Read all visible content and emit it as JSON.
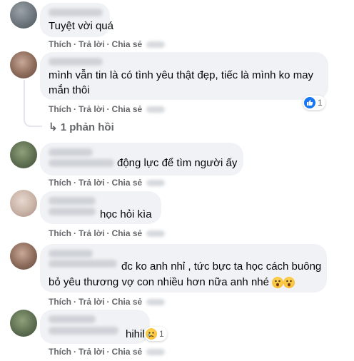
{
  "actions": {
    "like": "Thích",
    "reply": "Trả lời",
    "share": "Chia sẻ",
    "separator": "·"
  },
  "comments": [
    {
      "text": "Tuyệt vời quá"
    },
    {
      "text_line1": "mình vẫn tin là có tình yêu thật đẹp, tiếc là mình ko may",
      "text_line2": "mắn thôi",
      "reaction_count": "1"
    },
    {
      "text": "động lực để tìm người ấy"
    },
    {
      "text": "học hỏi kìa"
    },
    {
      "text_line1": "đc ko anh nhỉ , tức bực ta học cách buông",
      "text_line2": "bỏ yêu thương vợ con nhiều hơn nữa anh nhé"
    },
    {
      "text": "hihihi",
      "reaction_count": "1"
    }
  ],
  "replies_link": {
    "arrow": "↳",
    "label": "1 phản hồi"
  },
  "colors": {
    "bubble": "#f0f2f5",
    "action_text": "#65676b",
    "like_blue": "#1877f2"
  }
}
